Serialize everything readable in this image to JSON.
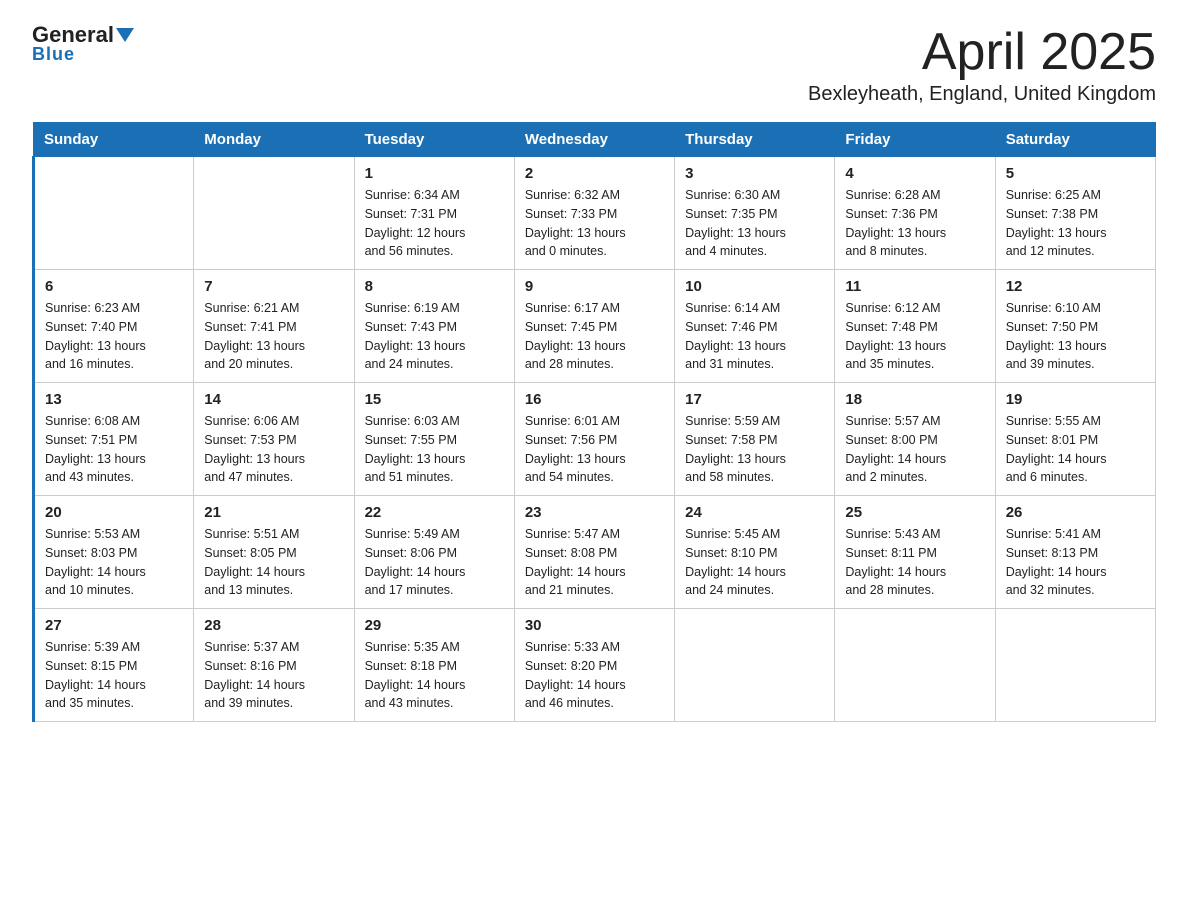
{
  "header": {
    "logo_general": "General",
    "logo_blue": "Blue",
    "title": "April 2025",
    "subtitle": "Bexleyheath, England, United Kingdom"
  },
  "days_of_week": [
    "Sunday",
    "Monday",
    "Tuesday",
    "Wednesday",
    "Thursday",
    "Friday",
    "Saturday"
  ],
  "weeks": [
    [
      {
        "day": "",
        "info": ""
      },
      {
        "day": "",
        "info": ""
      },
      {
        "day": "1",
        "info": "Sunrise: 6:34 AM\nSunset: 7:31 PM\nDaylight: 12 hours\nand 56 minutes."
      },
      {
        "day": "2",
        "info": "Sunrise: 6:32 AM\nSunset: 7:33 PM\nDaylight: 13 hours\nand 0 minutes."
      },
      {
        "day": "3",
        "info": "Sunrise: 6:30 AM\nSunset: 7:35 PM\nDaylight: 13 hours\nand 4 minutes."
      },
      {
        "day": "4",
        "info": "Sunrise: 6:28 AM\nSunset: 7:36 PM\nDaylight: 13 hours\nand 8 minutes."
      },
      {
        "day": "5",
        "info": "Sunrise: 6:25 AM\nSunset: 7:38 PM\nDaylight: 13 hours\nand 12 minutes."
      }
    ],
    [
      {
        "day": "6",
        "info": "Sunrise: 6:23 AM\nSunset: 7:40 PM\nDaylight: 13 hours\nand 16 minutes."
      },
      {
        "day": "7",
        "info": "Sunrise: 6:21 AM\nSunset: 7:41 PM\nDaylight: 13 hours\nand 20 minutes."
      },
      {
        "day": "8",
        "info": "Sunrise: 6:19 AM\nSunset: 7:43 PM\nDaylight: 13 hours\nand 24 minutes."
      },
      {
        "day": "9",
        "info": "Sunrise: 6:17 AM\nSunset: 7:45 PM\nDaylight: 13 hours\nand 28 minutes."
      },
      {
        "day": "10",
        "info": "Sunrise: 6:14 AM\nSunset: 7:46 PM\nDaylight: 13 hours\nand 31 minutes."
      },
      {
        "day": "11",
        "info": "Sunrise: 6:12 AM\nSunset: 7:48 PM\nDaylight: 13 hours\nand 35 minutes."
      },
      {
        "day": "12",
        "info": "Sunrise: 6:10 AM\nSunset: 7:50 PM\nDaylight: 13 hours\nand 39 minutes."
      }
    ],
    [
      {
        "day": "13",
        "info": "Sunrise: 6:08 AM\nSunset: 7:51 PM\nDaylight: 13 hours\nand 43 minutes."
      },
      {
        "day": "14",
        "info": "Sunrise: 6:06 AM\nSunset: 7:53 PM\nDaylight: 13 hours\nand 47 minutes."
      },
      {
        "day": "15",
        "info": "Sunrise: 6:03 AM\nSunset: 7:55 PM\nDaylight: 13 hours\nand 51 minutes."
      },
      {
        "day": "16",
        "info": "Sunrise: 6:01 AM\nSunset: 7:56 PM\nDaylight: 13 hours\nand 54 minutes."
      },
      {
        "day": "17",
        "info": "Sunrise: 5:59 AM\nSunset: 7:58 PM\nDaylight: 13 hours\nand 58 minutes."
      },
      {
        "day": "18",
        "info": "Sunrise: 5:57 AM\nSunset: 8:00 PM\nDaylight: 14 hours\nand 2 minutes."
      },
      {
        "day": "19",
        "info": "Sunrise: 5:55 AM\nSunset: 8:01 PM\nDaylight: 14 hours\nand 6 minutes."
      }
    ],
    [
      {
        "day": "20",
        "info": "Sunrise: 5:53 AM\nSunset: 8:03 PM\nDaylight: 14 hours\nand 10 minutes."
      },
      {
        "day": "21",
        "info": "Sunrise: 5:51 AM\nSunset: 8:05 PM\nDaylight: 14 hours\nand 13 minutes."
      },
      {
        "day": "22",
        "info": "Sunrise: 5:49 AM\nSunset: 8:06 PM\nDaylight: 14 hours\nand 17 minutes."
      },
      {
        "day": "23",
        "info": "Sunrise: 5:47 AM\nSunset: 8:08 PM\nDaylight: 14 hours\nand 21 minutes."
      },
      {
        "day": "24",
        "info": "Sunrise: 5:45 AM\nSunset: 8:10 PM\nDaylight: 14 hours\nand 24 minutes."
      },
      {
        "day": "25",
        "info": "Sunrise: 5:43 AM\nSunset: 8:11 PM\nDaylight: 14 hours\nand 28 minutes."
      },
      {
        "day": "26",
        "info": "Sunrise: 5:41 AM\nSunset: 8:13 PM\nDaylight: 14 hours\nand 32 minutes."
      }
    ],
    [
      {
        "day": "27",
        "info": "Sunrise: 5:39 AM\nSunset: 8:15 PM\nDaylight: 14 hours\nand 35 minutes."
      },
      {
        "day": "28",
        "info": "Sunrise: 5:37 AM\nSunset: 8:16 PM\nDaylight: 14 hours\nand 39 minutes."
      },
      {
        "day": "29",
        "info": "Sunrise: 5:35 AM\nSunset: 8:18 PM\nDaylight: 14 hours\nand 43 minutes."
      },
      {
        "day": "30",
        "info": "Sunrise: 5:33 AM\nSunset: 8:20 PM\nDaylight: 14 hours\nand 46 minutes."
      },
      {
        "day": "",
        "info": ""
      },
      {
        "day": "",
        "info": ""
      },
      {
        "day": "",
        "info": ""
      }
    ]
  ]
}
